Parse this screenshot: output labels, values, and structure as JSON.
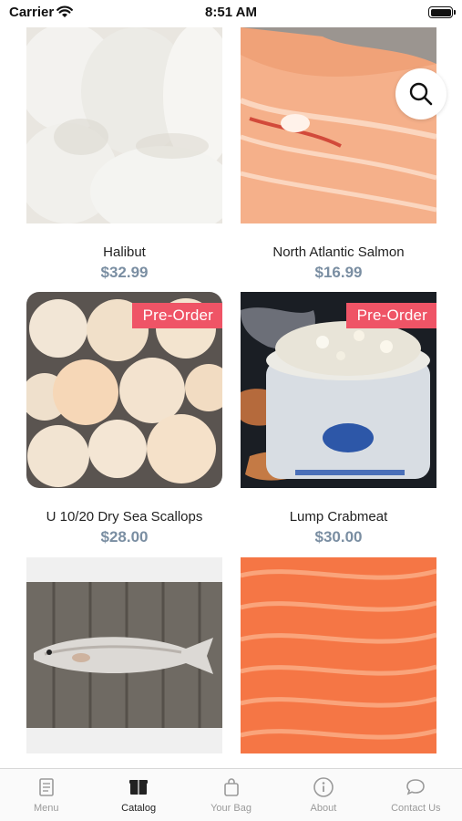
{
  "status_bar": {
    "carrier": "Carrier",
    "time": "8:51 AM"
  },
  "products": [
    {
      "name": "Halibut",
      "price": "$32.99",
      "badge": ""
    },
    {
      "name": "North Atlantic Salmon",
      "price": "$16.99",
      "badge": ""
    },
    {
      "name": "U 10/20 Dry Sea Scallops",
      "price": "$28.00",
      "badge": "Pre-Order"
    },
    {
      "name": "Lump Crabmeat",
      "price": "$30.00",
      "badge": "Pre-Order"
    },
    {
      "name": "",
      "price": "",
      "badge": ""
    },
    {
      "name": "",
      "price": "",
      "badge": ""
    }
  ],
  "search_button": {
    "icon": "search-icon"
  },
  "tab_bar": {
    "items": [
      {
        "label": "Menu",
        "icon": "menu-book-icon",
        "active": false
      },
      {
        "label": "Catalog",
        "icon": "catalog-box-icon",
        "active": true
      },
      {
        "label": "Your Bag",
        "icon": "shopping-bag-icon",
        "active": false
      },
      {
        "label": "About",
        "icon": "info-icon",
        "active": false
      },
      {
        "label": "Contact Us",
        "icon": "chat-bubble-icon",
        "active": false
      }
    ]
  },
  "colors": {
    "badge": "#ef5466",
    "price": "#7a8ea2",
    "tab_active": "#222222",
    "tab_inactive": "#9a9a9a"
  }
}
